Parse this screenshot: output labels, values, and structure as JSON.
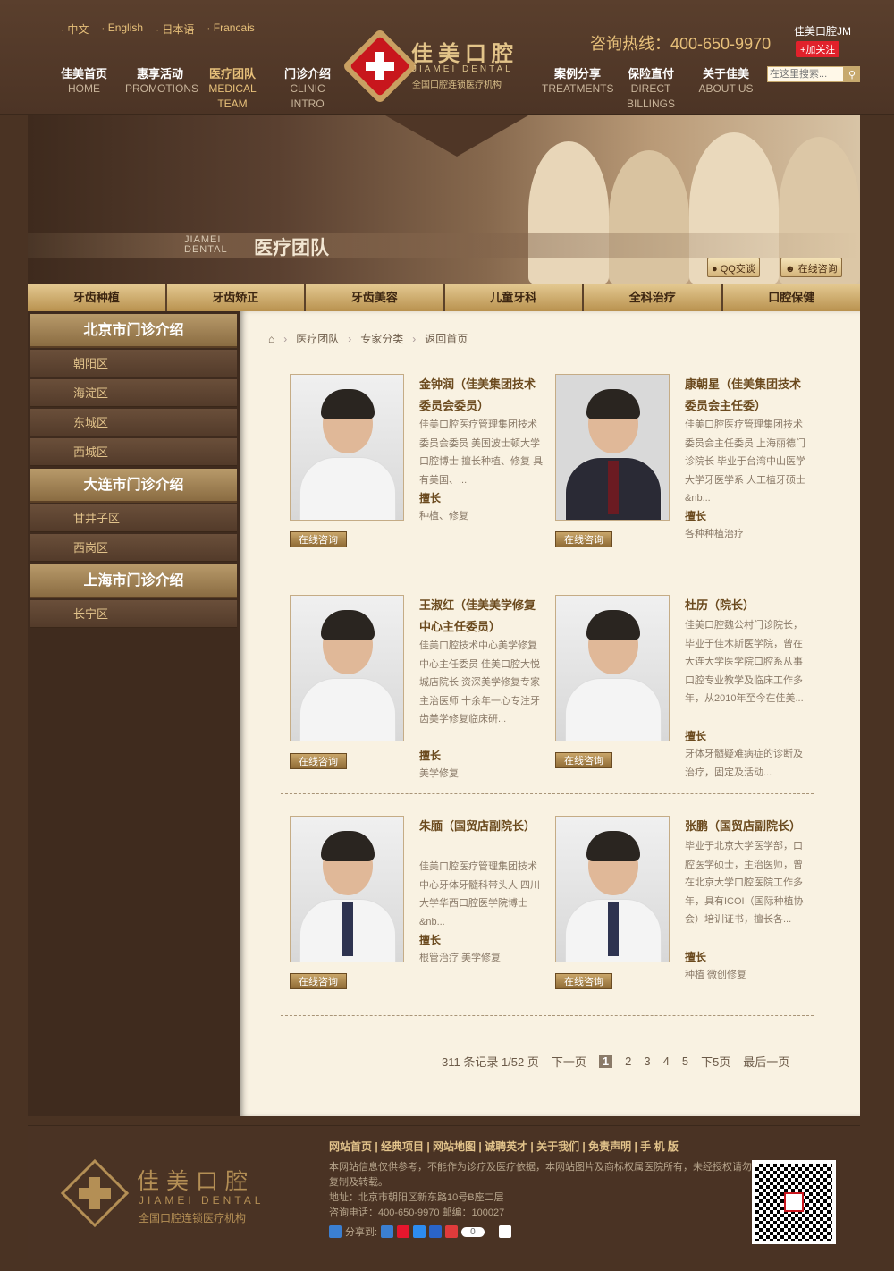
{
  "header": {
    "languages": [
      "中文",
      "English",
      "日本语",
      "Francais"
    ],
    "nav": [
      {
        "cn": "佳美首页",
        "en": "HOME"
      },
      {
        "cn": "惠享活动",
        "en": "PROMOTIONS"
      },
      {
        "cn": "医疗团队",
        "en": "MEDICAL TEAM"
      },
      {
        "cn": "门诊介绍",
        "en": "CLINIC INTRO"
      },
      {
        "cn": "案例分享",
        "en": "TREATMENTS"
      },
      {
        "cn": "保险直付",
        "en": "DIRECT BILLINGS"
      },
      {
        "cn": "关于佳美",
        "en": "ABOUT US"
      }
    ],
    "logo_cn": "佳美口腔",
    "logo_en": "JIAMEI DENTAL",
    "logo_sub": "全国口腔连锁医疗机构",
    "hotline": "咨询热线：400-650-9970",
    "weibo_name": "佳美口腔JM",
    "follow_label": "+加关注",
    "search_placeholder": "在这里搜索..."
  },
  "banner": {
    "en_line1": "JIAMEI",
    "en_line2": "DENTAL",
    "title": "医疗团队",
    "qq_label": "QQ交谈",
    "online_label": "在线咨询"
  },
  "categories": [
    "牙齿种植",
    "牙齿矫正",
    "牙齿美容",
    "儿童牙科",
    "全科治疗",
    "口腔保健"
  ],
  "sidebar": {
    "sections": [
      {
        "title": "北京市门诊介绍",
        "items": [
          "朝阳区",
          "海淀区",
          "东城区",
          "西城区"
        ]
      },
      {
        "title": "大连市门诊介绍",
        "items": [
          "甘井子区",
          "西岗区"
        ]
      },
      {
        "title": "上海市门诊介绍",
        "items": [
          "长宁区"
        ]
      }
    ]
  },
  "breadcrumb": [
    "医疗团队",
    "专家分类",
    "返回首页"
  ],
  "doctors": [
    {
      "name": "金钟润（佳美集团技术委员会委员）",
      "desc": "佳美口腔医疗管理集团技术委员会委员 美国波士顿大学 口腔博士 擅长种植、修复 具有美国、...",
      "spec_label": "擅长",
      "spec": "种植、修复",
      "consult": "在线咨询"
    },
    {
      "name": "康朝星（佳美集团技术委员会主任委）",
      "desc": "佳美口腔医疗管理集团技术委员会主任委员 上海丽德门诊院长 毕业于台湾中山医学大学牙医学系 人工植牙硕士&nb...",
      "spec_label": "擅长",
      "spec": "各种种植治疗",
      "consult": "在线咨询"
    },
    {
      "name": "王淑红（佳美美学修复中心主任委员）",
      "desc": "佳美口腔技术中心美学修复中心主任委员 佳美口腔大悦城店院长 资深美学修复专家 主治医师 十余年一心专注牙齿美学修复临床研...",
      "spec_label": "擅长",
      "spec": "美学修复",
      "consult": "在线咨询"
    },
    {
      "name": "杜历（院长）",
      "desc": "佳美口腔魏公村门诊院长，毕业于佳木斯医学院，曾在大连大学医学院口腔系从事口腔专业教学及临床工作多年，从2010年至今在佳美...",
      "spec_label": "擅长",
      "spec": "牙体牙髓疑难病症的诊断及治疗，固定及活动...",
      "consult": "在线咨询"
    },
    {
      "name": "朱腼（国贸店副院长）",
      "desc": "佳美口腔医疗管理集团技术中心牙体牙髓科带头人 四川大学华西口腔医学院博士 &nb...",
      "spec_label": "擅长",
      "spec": "根管治疗 美学修复",
      "consult": "在线咨询"
    },
    {
      "name": "张鹏（国贸店副院长）",
      "desc": "毕业于北京大学医学部，口腔医学硕士，主治医师，曾在北京大学口腔医院工作多年，具有ICOI（国际种植协会）培训证书，擅长各...",
      "spec_label": "擅长",
      "spec": "种植 微创修复",
      "consult": "在线咨询"
    }
  ],
  "pager": {
    "summary": "311 条记录 1/52 页",
    "next": "下一页",
    "pages": [
      "1",
      "2",
      "3",
      "4",
      "5"
    ],
    "next5": "下5页",
    "last": "最后一页"
  },
  "footer": {
    "links": "网站首页 | 经典项目 | 网站地图 | 诚聘英才 | 关于我们 | 免责声明 | 手 机 版",
    "info": "本网站信息仅供参考，不能作为诊疗及医疗依据，本网站图片及商标权属医院所有，未经授权请勿复制及转载。",
    "address": "地址：北京市朝阳区新东路10号B座二层",
    "phone_zip": "咨询电话：400-650-9970    邮编：100027",
    "share_label": "分享到:",
    "share_count": "0",
    "logo_cn": "佳美口腔",
    "logo_en": "JIAMEI DENTAL",
    "logo_sub": "全国口腔连锁医疗机构"
  },
  "colors": {
    "gold": "#e7c07a",
    "brand_red": "#c8161d",
    "panel": "#f9f2e2"
  }
}
